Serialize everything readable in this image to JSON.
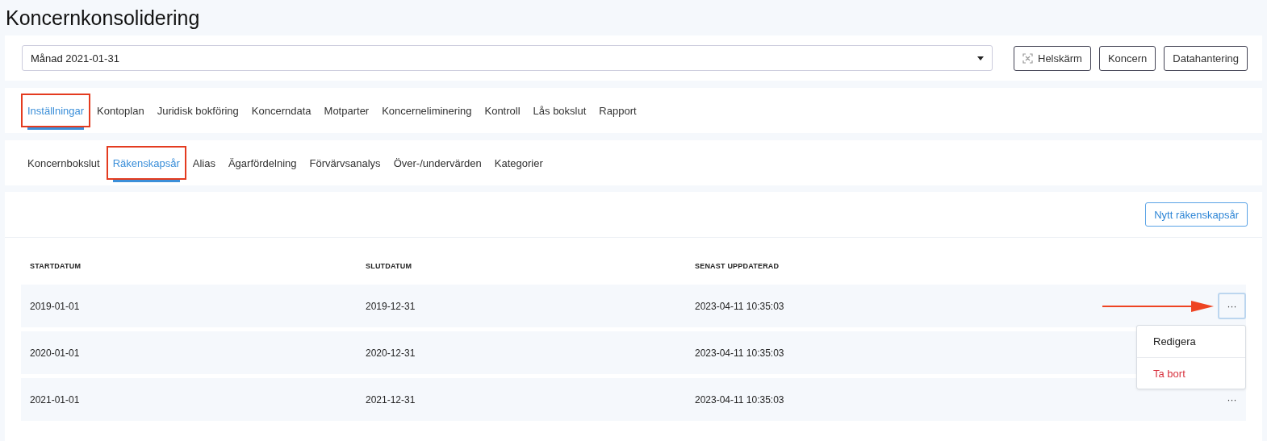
{
  "page_title": "Koncernkonsolidering",
  "period_select": {
    "value": "Månad 2021-01-31"
  },
  "header_buttons": [
    {
      "label": "Helskärm",
      "kind": "fullscreen"
    },
    {
      "label": "Koncern",
      "kind": "plain"
    },
    {
      "label": "Datahantering",
      "kind": "plain"
    }
  ],
  "main_tabs": [
    {
      "label": "Inställningar",
      "selected": true,
      "highlighted": true
    },
    {
      "label": "Kontoplan",
      "selected": false,
      "highlighted": false
    },
    {
      "label": "Juridisk bokföring",
      "selected": false,
      "highlighted": false
    },
    {
      "label": "Koncerndata",
      "selected": false,
      "highlighted": false
    },
    {
      "label": "Motparter",
      "selected": false,
      "highlighted": false
    },
    {
      "label": "Koncerneliminering",
      "selected": false,
      "highlighted": false
    },
    {
      "label": "Kontroll",
      "selected": false,
      "highlighted": false
    },
    {
      "label": "Lås bokslut",
      "selected": false,
      "highlighted": false
    },
    {
      "label": "Rapport",
      "selected": false,
      "highlighted": false
    }
  ],
  "sub_tabs": [
    {
      "label": "Koncernbokslut",
      "selected": false,
      "highlighted": false
    },
    {
      "label": "Räkenskapsår",
      "selected": true,
      "highlighted": true
    },
    {
      "label": "Alias",
      "selected": false,
      "highlighted": false
    },
    {
      "label": "Ägarfördelning",
      "selected": false,
      "highlighted": false
    },
    {
      "label": "Förvärvsanalys",
      "selected": false,
      "highlighted": false
    },
    {
      "label": "Över-/undervärden",
      "selected": false,
      "highlighted": false
    },
    {
      "label": "Kategorier",
      "selected": false,
      "highlighted": false
    }
  ],
  "new_button": {
    "label": "Nytt räkenskapsår"
  },
  "table": {
    "columns": [
      "STARTDATUM",
      "SLUTDATUM",
      "SENAST UPPDATERAD"
    ],
    "rows": [
      {
        "cells": [
          "2019-01-01",
          "2019-12-31",
          "2023-04-11 10:35:03"
        ],
        "menu_open": true,
        "arrow": true
      },
      {
        "cells": [
          "2020-01-01",
          "2020-12-31",
          "2023-04-11 10:35:03"
        ],
        "menu_open": false,
        "arrow": false
      },
      {
        "cells": [
          "2021-01-01",
          "2021-12-31",
          "2023-04-11 10:35:03"
        ],
        "menu_open": false,
        "arrow": false
      }
    ],
    "actions_label": "···"
  },
  "row_menu": [
    {
      "label": "Redigera",
      "kind": "normal"
    },
    {
      "label": "Ta bort",
      "kind": "danger"
    }
  ]
}
